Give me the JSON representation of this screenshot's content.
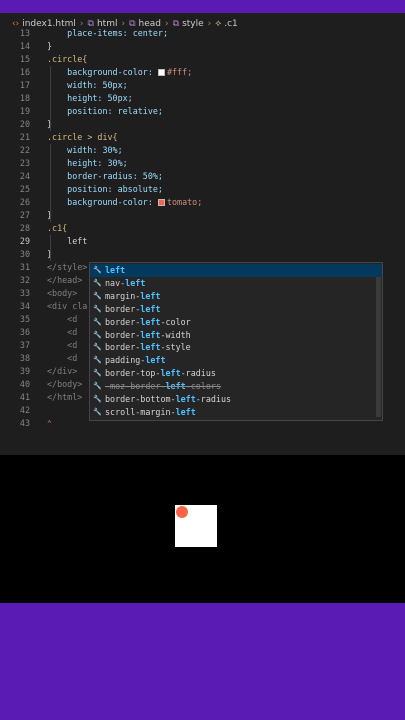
{
  "breadcrumb": {
    "items": [
      {
        "icon": "‹›",
        "label": "index1.html"
      },
      {
        "icon": "⧉",
        "label": "html"
      },
      {
        "icon": "⧉",
        "label": "head"
      },
      {
        "icon": "⧉",
        "label": "style"
      },
      {
        "icon": "⟡",
        "label": ".c1"
      }
    ]
  },
  "code": {
    "lines": [
      {
        "n": "13",
        "text": "    place-items: center;"
      },
      {
        "n": "14",
        "text": "}"
      },
      {
        "n": "15",
        "text": ".circle{"
      },
      {
        "n": "16",
        "text": "    background-color: ",
        "swatch": "#ffffff",
        "value": "#fff;"
      },
      {
        "n": "17",
        "text": "    width: 50px;"
      },
      {
        "n": "18",
        "text": "    height: 50px;"
      },
      {
        "n": "19",
        "text": "    position: relative;"
      },
      {
        "n": "20",
        "text": "}"
      },
      {
        "n": "21",
        "text": ".circle > div{"
      },
      {
        "n": "22",
        "text": "    width: 30%;"
      },
      {
        "n": "23",
        "text": "    height: 30%;"
      },
      {
        "n": "24",
        "text": "    border-radius: 50%;"
      },
      {
        "n": "25",
        "text": "    position: absolute;"
      },
      {
        "n": "26",
        "text": "    background-color: ",
        "swatch": "#ff6347",
        "value": "tomato;"
      },
      {
        "n": "27",
        "text": "}"
      },
      {
        "n": "28",
        "text": ".c1{"
      },
      {
        "n": "29",
        "text": "    left"
      },
      {
        "n": "30",
        "text": "}"
      },
      {
        "n": "31",
        "text": "</style>"
      },
      {
        "n": "32",
        "text": "</head>"
      },
      {
        "n": "33",
        "text": "<body>"
      },
      {
        "n": "34",
        "text": "<div cla"
      },
      {
        "n": "35",
        "text": "    <d"
      },
      {
        "n": "36",
        "text": "    <d"
      },
      {
        "n": "37",
        "text": "    <d"
      },
      {
        "n": "38",
        "text": "    <d"
      },
      {
        "n": "39",
        "text": "</div>"
      },
      {
        "n": "40",
        "text": "</body>"
      },
      {
        "n": "41",
        "text": "</html>"
      },
      {
        "n": "42",
        "text": ""
      },
      {
        "n": "43",
        "text": ""
      }
    ]
  },
  "suggestions": [
    {
      "pre": "",
      "hl": "left",
      "post": ""
    },
    {
      "pre": "nav-",
      "hl": "left",
      "post": ""
    },
    {
      "pre": "margin-",
      "hl": "left",
      "post": ""
    },
    {
      "pre": "border-",
      "hl": "left",
      "post": ""
    },
    {
      "pre": "border-",
      "hl": "left",
      "post": "-color"
    },
    {
      "pre": "border-",
      "hl": "left",
      "post": "-width"
    },
    {
      "pre": "border-",
      "hl": "left",
      "post": "-style"
    },
    {
      "pre": "padding-",
      "hl": "left",
      "post": ""
    },
    {
      "pre": "border-top-",
      "hl": "left",
      "post": "-radius"
    },
    {
      "pre": "-moz-border-",
      "hl": "left",
      "post": "-colors"
    },
    {
      "pre": "border-bottom-",
      "hl": "left",
      "post": "-radius"
    },
    {
      "pre": "scroll-margin-",
      "hl": "left",
      "post": ""
    }
  ],
  "colors": {
    "accent": "#5a1ab4",
    "editor_bg": "#1e1e1e",
    "dot": "#ff6347",
    "selection": "#04395e"
  }
}
